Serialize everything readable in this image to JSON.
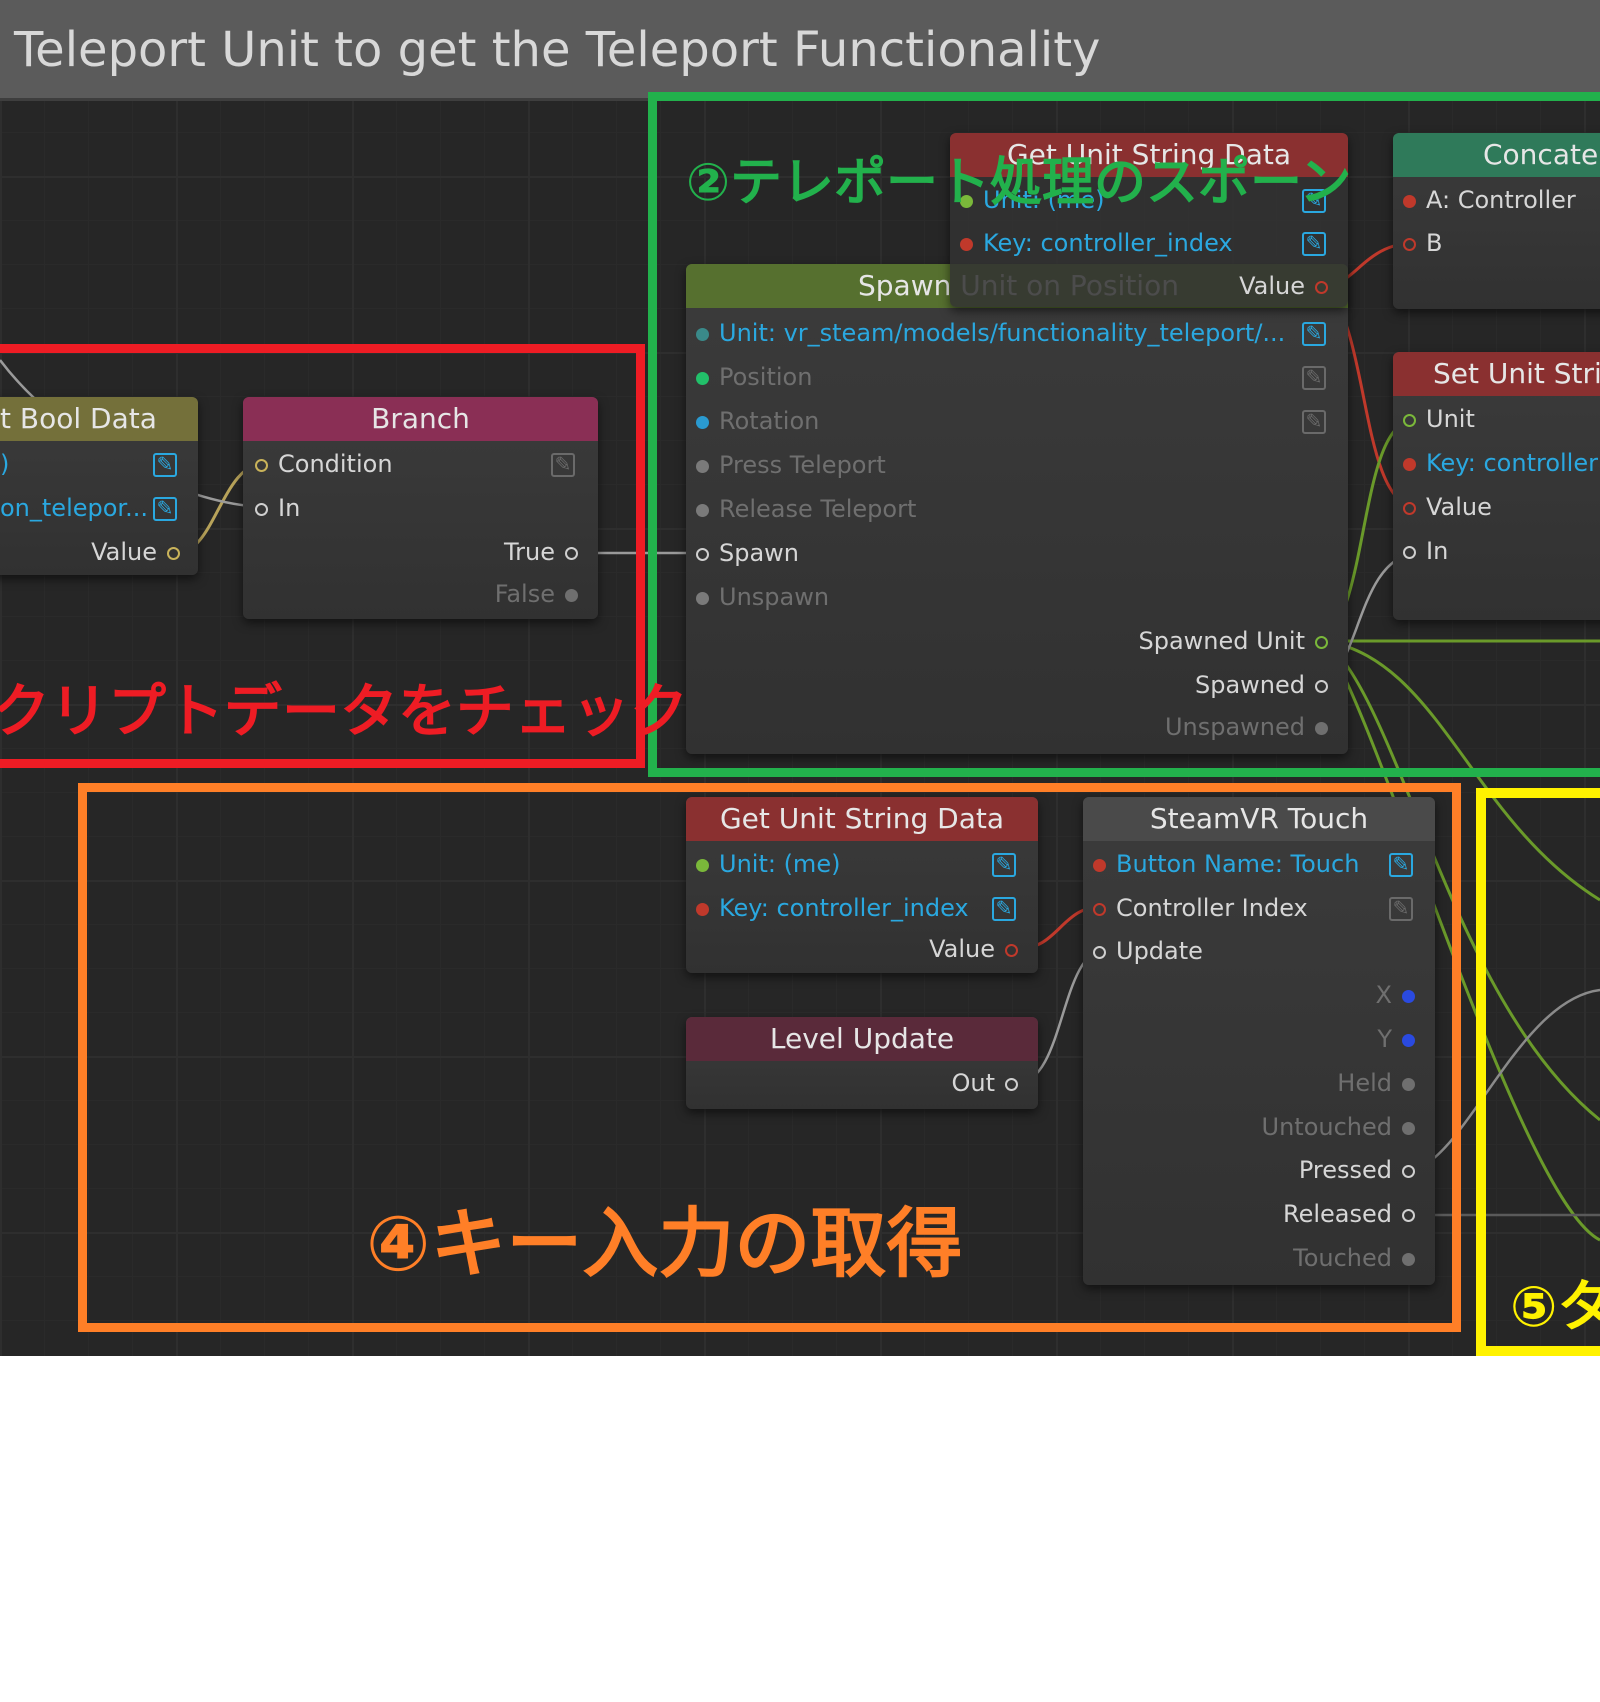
{
  "window": {
    "title": "Teleport Unit to get the Teleport Functionality"
  },
  "annotations": {
    "red": "クリプトデータをチェック",
    "green": "②テレポート処理のスポーン",
    "orange": "④キー入力の取得",
    "yellow": "⑤タ"
  },
  "frame_colors": {
    "red": "#ee1c24",
    "green": "#22b14c",
    "orange": "#ff7f27",
    "yellow": "#fff200"
  },
  "nodes": {
    "bool_data": {
      "title": "t Bool Data",
      "pin1": ")",
      "pin2": "on_telepor...",
      "value": "Value"
    },
    "branch": {
      "title": "Branch",
      "condition": "Condition",
      "in": "In",
      "true": "True",
      "false": "False"
    },
    "spawn": {
      "title": "Spawn Unit on Position",
      "unit": "Unit: vr_steam/models/functionality_teleport/...",
      "position": "Position",
      "rotation": "Rotation",
      "press_teleport": "Press Teleport",
      "release_teleport": "Release Teleport",
      "spawn": "Spawn",
      "unspawn": "Unspawn",
      "spawned_unit": "Spawned Unit",
      "spawned": "Spawned",
      "unspawned": "Unspawned"
    },
    "get_string_top": {
      "title": "Get Unit String Data",
      "unit": "Unit: (me)",
      "key": "Key: controller_index",
      "value": "Value"
    },
    "concat": {
      "title": "Concatenate",
      "a": "A: Controller",
      "b": "B"
    },
    "set_string": {
      "title": "Set Unit String",
      "unit": "Unit",
      "key": "Key: controller",
      "value": "Value",
      "in": "In"
    },
    "get_string_bottom": {
      "title": "Get Unit String Data",
      "unit": "Unit: (me)",
      "key": "Key: controller_index",
      "value": "Value"
    },
    "level_update": {
      "title": "Level Update",
      "out": "Out"
    },
    "steamvr": {
      "title": "SteamVR Touch",
      "button": "Button Name: Touch",
      "controller": "Controller Index",
      "update": "Update",
      "x": "X",
      "y": "Y",
      "held": "Held",
      "untouched": "Untouched",
      "pressed": "Pressed",
      "released": "Released",
      "touched": "Touched"
    }
  },
  "icons": {
    "edit": "edit-icon",
    "pin": "pin-icon"
  }
}
